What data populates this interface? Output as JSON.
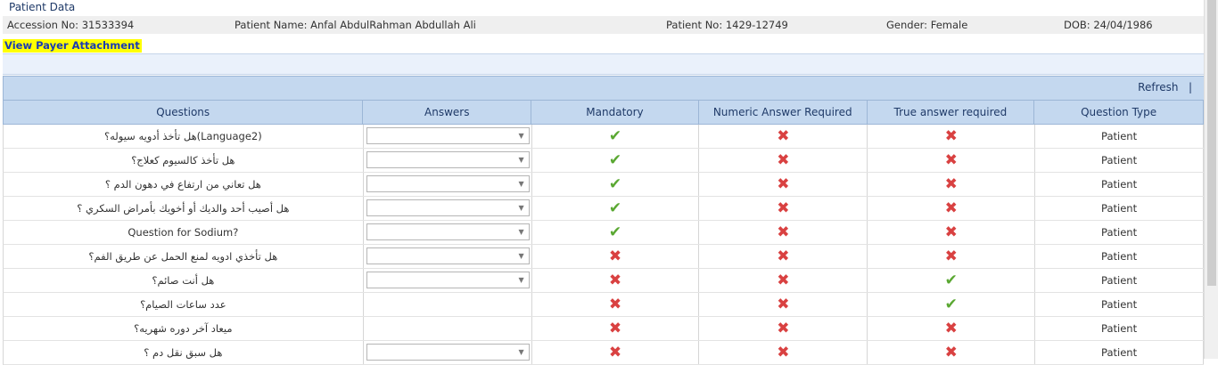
{
  "patient": {
    "section_title": "Patient Data",
    "accession": "Accession No: 31533394",
    "name": "Patient Name: Anfal AbdulRahman Abdullah Ali",
    "patient_no": "Patient No: 1429-12749",
    "gender": "Gender: Female",
    "dob": "DOB: 24/04/1986"
  },
  "payer_link": "View Payer Attachment",
  "toolbar": {
    "refresh": "Refresh",
    "separator": "|"
  },
  "columns": [
    "Questions",
    "Answers",
    "Mandatory",
    "Numeric Answer Required",
    "True answer required",
    "Question Type"
  ],
  "rows": [
    {
      "question": "هل تأخذ أدويه سيوله؟(Language2)",
      "has_dropdown": true,
      "mandatory": true,
      "numeric": false,
      "true_answer": false,
      "type": "Patient"
    },
    {
      "question": "هل تأخذ كالسيوم كعلاج؟",
      "has_dropdown": true,
      "mandatory": true,
      "numeric": false,
      "true_answer": false,
      "type": "Patient"
    },
    {
      "question": "هل تعاني من ارتفاع في دهون الدم ؟",
      "has_dropdown": true,
      "mandatory": true,
      "numeric": false,
      "true_answer": false,
      "type": "Patient"
    },
    {
      "question": "هل أصيب أحد والديك أو أخويك بأمراض السكري ؟",
      "has_dropdown": true,
      "mandatory": true,
      "numeric": false,
      "true_answer": false,
      "type": "Patient"
    },
    {
      "question": "Question for Sodium?",
      "has_dropdown": true,
      "mandatory": true,
      "numeric": false,
      "true_answer": false,
      "type": "Patient"
    },
    {
      "question": "هل تأخذي ادويه لمنع الحمل عن طريق الفم؟",
      "has_dropdown": true,
      "mandatory": false,
      "numeric": false,
      "true_answer": false,
      "type": "Patient"
    },
    {
      "question": "هل أنت صائم؟",
      "has_dropdown": true,
      "mandatory": false,
      "numeric": false,
      "true_answer": true,
      "type": "Patient"
    },
    {
      "question": "عدد ساعات الصيام؟",
      "has_dropdown": false,
      "mandatory": false,
      "numeric": false,
      "true_answer": true,
      "type": "Patient"
    },
    {
      "question": "ميعاد آخر دوره شهريه؟",
      "has_dropdown": false,
      "mandatory": false,
      "numeric": false,
      "true_answer": false,
      "type": "Patient"
    },
    {
      "question": "هل سبق نقل دم ؟",
      "has_dropdown": true,
      "mandatory": false,
      "numeric": false,
      "true_answer": false,
      "type": "Patient"
    }
  ],
  "icons": {
    "yes": "check-icon",
    "no": "cross-icon",
    "yes_color": "#5aa832",
    "no_color": "#d94141"
  }
}
